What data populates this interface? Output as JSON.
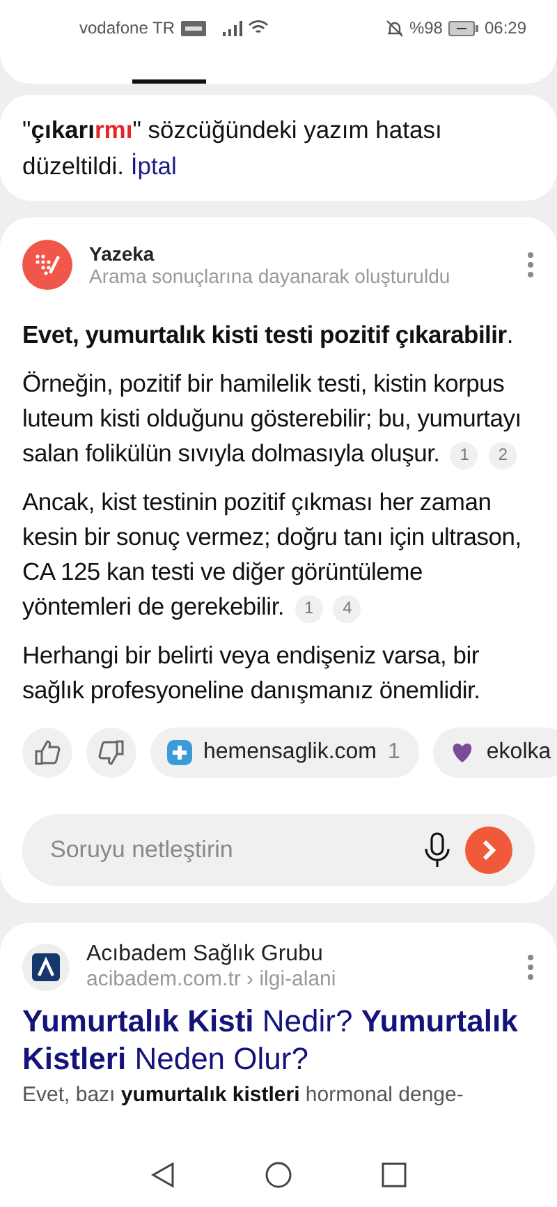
{
  "status_bar": {
    "carrier": "vodafone TR",
    "battery": "%98",
    "time": "06:29"
  },
  "spell_notice": {
    "quote_open": "\"",
    "word_kept": "çıkarı",
    "word_fixed": "rmı",
    "rest": "\" sözcüğündeki yazım hatası düzeltildi.",
    "cancel_link": "İptal"
  },
  "answer": {
    "source_name": "Yazeka",
    "source_subtitle": "Arama sonuçlarına dayanarak oluşturuldu",
    "paragraphs": [
      {
        "text": "**Evet, yumurtalık kisti testi pozitif çıkarabilir**."
      },
      {
        "text": "Örneğin, pozitif bir hamilelik testi, kistin korpus luteum kisti olduğunu gösterebilir; bu, yumurtayı salan folikülün sıvıyla dolmasıyla oluşur.",
        "citations": [
          "1",
          "2"
        ]
      },
      {
        "text": "Ancak, kist testinin pozitif çıkması her zaman kesin bir sonuç vermez; doğru tanı için ultrason, CA 125 kan testi ve diğer görüntüleme yöntemleri de gerekebilir.",
        "citations": [
          "1",
          "4"
        ]
      },
      {
        "text": "Herhangi bir belirti veya endişeniz varsa, bir sağlık profesyoneline danışmanız önemlidir."
      }
    ],
    "sources": [
      {
        "kind": "hemen",
        "label": "hemensaglik.com",
        "count": "1"
      },
      {
        "kind": "ekol",
        "label": "ekolka"
      }
    ],
    "refine": {
      "placeholder": "Soruyu netleştirin"
    }
  },
  "result": {
    "site": "Acıbadem Sağlık Grubu",
    "url": "acibadem.com.tr › ilgi-alani",
    "title": "**Yumurtalık Kisti** Nedir? **Yumurtalık Kistleri** Neden Olur?",
    "snippet": "Evet, bazı **yumurtalık kistleri** hormonal denge-"
  }
}
